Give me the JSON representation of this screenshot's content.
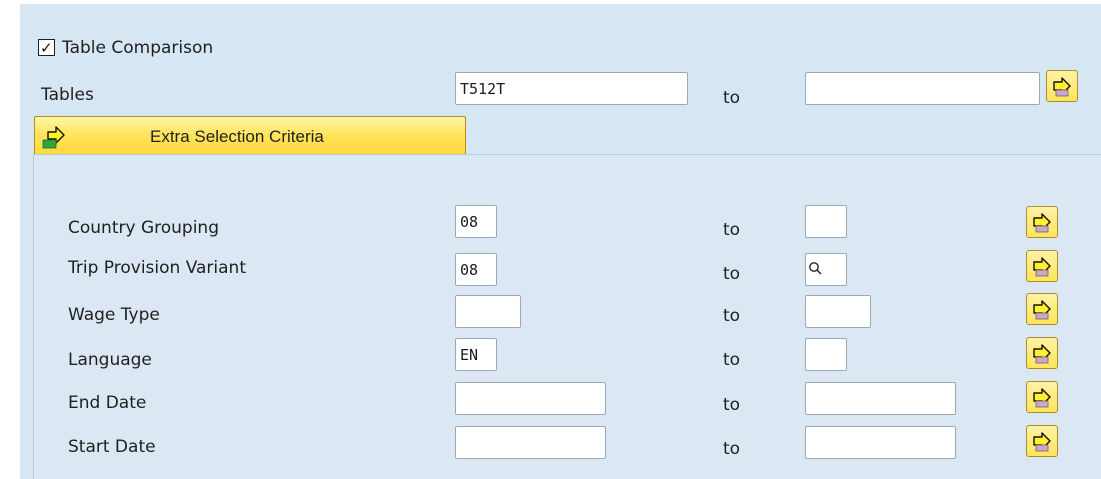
{
  "table_comparison": {
    "checkbox_label": "Table Comparison",
    "checked": true
  },
  "tables": {
    "label": "Tables",
    "from_value": "T512T",
    "to_label": "to",
    "to_value": ""
  },
  "extra_selection": {
    "label": "Extra Selection Criteria"
  },
  "criteria": [
    {
      "label": "Country Grouping",
      "from_value": "08",
      "to_label": "to",
      "to_value": ""
    },
    {
      "label": "Trip Provision Variant",
      "from_value": "08",
      "to_label": "to",
      "to_value": "",
      "to_icon": "search-icon"
    },
    {
      "label": "Wage Type",
      "from_value": "",
      "to_label": "to",
      "to_value": ""
    },
    {
      "label": "Language",
      "from_value": "EN",
      "to_label": "to",
      "to_value": ""
    },
    {
      "label": "End Date",
      "from_value": "",
      "to_label": "to",
      "to_value": ""
    },
    {
      "label": "Start Date",
      "from_value": "",
      "to_label": "to",
      "to_value": ""
    }
  ],
  "icons": {
    "multiple_selection_button": "yellow-arrow-icon",
    "extra_selection_button": "yellow-green-arrow-icon",
    "search": "search-icon",
    "checkmark": "check-icon"
  },
  "colors": {
    "background": "#d7e6f3",
    "button_yellow": "#ffe45d",
    "field_border": "#98a9b8"
  }
}
